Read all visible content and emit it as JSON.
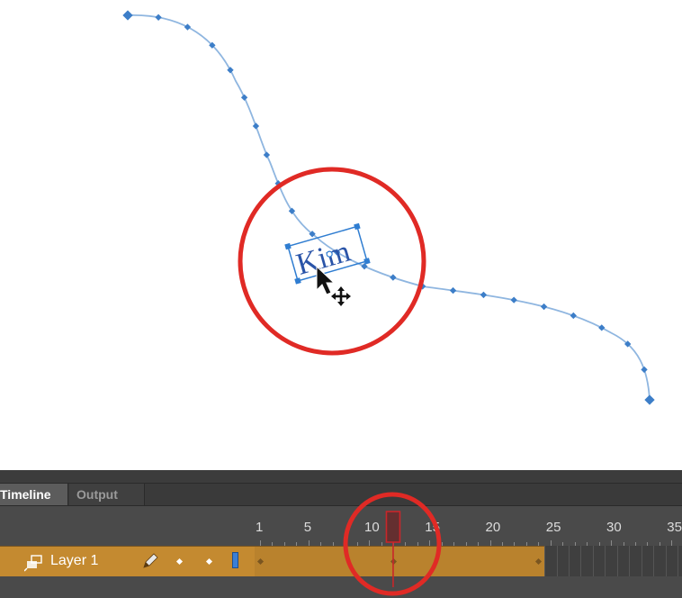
{
  "stage": {
    "symbol_text": "Kim"
  },
  "tabs": [
    {
      "label": "Timeline",
      "active": true
    },
    {
      "label": "Output",
      "active": false
    }
  ],
  "header_icons": [
    "eye-icon",
    "lock-icon",
    "outline-icon"
  ],
  "frame_numbers": [
    "1",
    "5",
    "10",
    "15",
    "20",
    "25",
    "30",
    "35"
  ],
  "current_frame": 12,
  "tween_end_frame": 24,
  "layers": [
    {
      "name": "Layer 1"
    }
  ],
  "colors": {
    "motion_path": "#8fb6e0",
    "path_node": "#3d7ec8",
    "annotation_circle": "#e02a25",
    "playhead": "#c8262a",
    "tween_span": "#b9822d",
    "layer_highlight": "#c48a30",
    "panel_bg": "#4a4a4a"
  }
}
